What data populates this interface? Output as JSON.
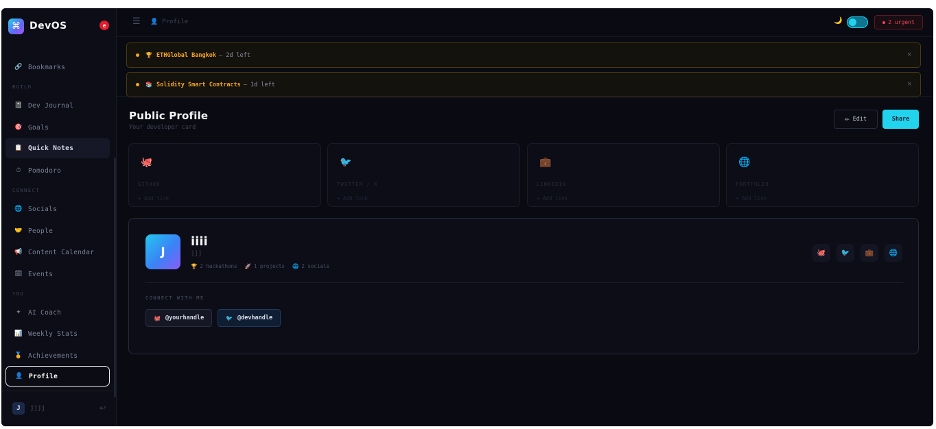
{
  "brand": {
    "name": "DevOS",
    "logo_glyph": "⌘",
    "badge": "e"
  },
  "sidebar": {
    "sections": [
      "BUILD",
      "CONNECT",
      "YOU"
    ],
    "items": [
      {
        "label": "Bookmarks",
        "icon": "link-icon",
        "glyph": "🔗"
      },
      {
        "label": "Dev Journal",
        "icon": "notebook-icon",
        "glyph": "📓"
      },
      {
        "label": "Goals",
        "icon": "target-icon",
        "glyph": "🎯"
      },
      {
        "label": "Quick Notes",
        "icon": "notepad-icon",
        "glyph": "📋"
      },
      {
        "label": "Pomodoro",
        "icon": "timer-icon",
        "glyph": "⏱"
      },
      {
        "label": "Socials",
        "icon": "globe-icon",
        "glyph": "🌐"
      },
      {
        "label": "People",
        "icon": "handshake-icon",
        "glyph": "🤝"
      },
      {
        "label": "Content Calendar",
        "icon": "megaphone-icon",
        "glyph": "📢"
      },
      {
        "label": "Events",
        "icon": "calendar-icon",
        "glyph": "🗓"
      },
      {
        "label": "AI Coach",
        "icon": "sparkle-icon",
        "glyph": "✦"
      },
      {
        "label": "Weekly Stats",
        "icon": "bar-chart-icon",
        "glyph": "📊"
      },
      {
        "label": "Achievements",
        "icon": "medal-icon",
        "glyph": "🏅"
      },
      {
        "label": "Profile",
        "icon": "user-icon",
        "glyph": "👤"
      }
    ],
    "user": {
      "initial": "J",
      "name": "jjjj",
      "logout_glyph": "↩"
    }
  },
  "topbar": {
    "menu_glyph": "☰",
    "breadcrumb": "Profile",
    "breadcrumb_glyph": "👤",
    "theme_glyph": "🌙",
    "urgent_label": "2 urgent"
  },
  "alerts": [
    {
      "icon_glyph": "🏆",
      "title": "ETHGlobal Bangkok",
      "rest": "— 2d left",
      "close": "×"
    },
    {
      "icon_glyph": "📚",
      "title": "Solidity Smart Contracts",
      "rest": "— 1d left",
      "close": "×"
    }
  ],
  "header": {
    "title": "Public Profile",
    "subtitle": "Your developer card",
    "edit_label": "Edit",
    "edit_glyph": "✏",
    "share_label": "Share"
  },
  "social_cards": [
    {
      "name": "GITHUB",
      "add": "+ Add link",
      "glyph": "🐙"
    },
    {
      "name": "TWITTER / X",
      "add": "+ Add link",
      "glyph": "🐦"
    },
    {
      "name": "LINKEDIN",
      "add": "+ Add link",
      "glyph": "💼"
    },
    {
      "name": "PORTFOLIO",
      "add": "+ Add link",
      "glyph": "🌐"
    }
  ],
  "profile": {
    "initial": "J",
    "name": "iiii",
    "handle": "jjj",
    "stats": [
      {
        "glyph": "🏆",
        "label": "2 hackathons"
      },
      {
        "glyph": "🚀",
        "label": "1 projects"
      },
      {
        "glyph": "🌐",
        "label": "2 socials"
      }
    ],
    "tile_glyphs": [
      "🐙",
      "🐦",
      "💼",
      "🌐"
    ],
    "connect_label": "CONNECT WITH ME",
    "chips": [
      {
        "glyph": "🐙",
        "label": "@yourhandle"
      },
      {
        "glyph": "🐦",
        "label": "@devhandle"
      }
    ]
  },
  "colors": {
    "accent": "#22d3ee",
    "warning": "#f5a524",
    "danger": "#f04458",
    "background": "#0a0b12"
  }
}
